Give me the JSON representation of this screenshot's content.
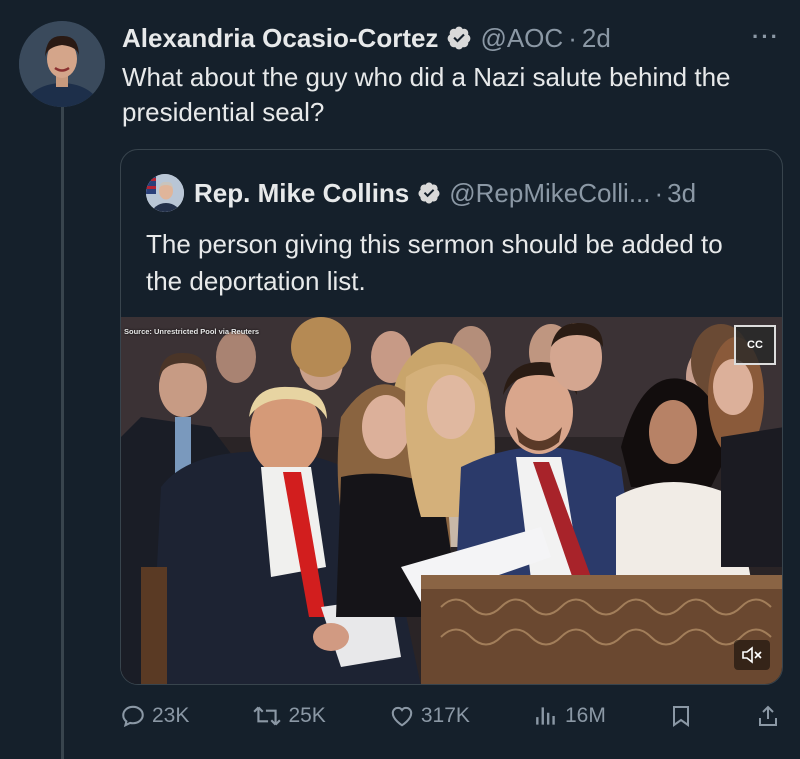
{
  "author": {
    "name": "Alexandria Ocasio-Cortez",
    "handle": "@AOC",
    "time": "2d",
    "separator": "·",
    "more_label": "···"
  },
  "tweet_text": "What about the guy who did a Nazi salute behind the presidential seal?",
  "quoted": {
    "name": "Rep. Mike Collins",
    "handle": "@RepMikeColli...",
    "separator": "·",
    "time": "3d",
    "text": "The person giving this sermon should be added to the deportation list.",
    "media": {
      "source_caption": "Source: Unrestricted Pool via Reuters",
      "cc_label": "CC",
      "description": "muted video"
    }
  },
  "actions": {
    "replies": "23K",
    "reposts": "25K",
    "likes": "317K",
    "views": "16M"
  },
  "colors": {
    "background": "#15202b",
    "text": "#e7e9ea",
    "secondary": "#8b98a5",
    "border": "#38444d",
    "verified": "#1d9bf0"
  },
  "icons": [
    "verified-badge-icon",
    "more-icon",
    "reply-icon",
    "repost-icon",
    "like-icon",
    "views-icon",
    "bookmark-icon",
    "share-icon",
    "cc-icon",
    "mute-icon"
  ]
}
